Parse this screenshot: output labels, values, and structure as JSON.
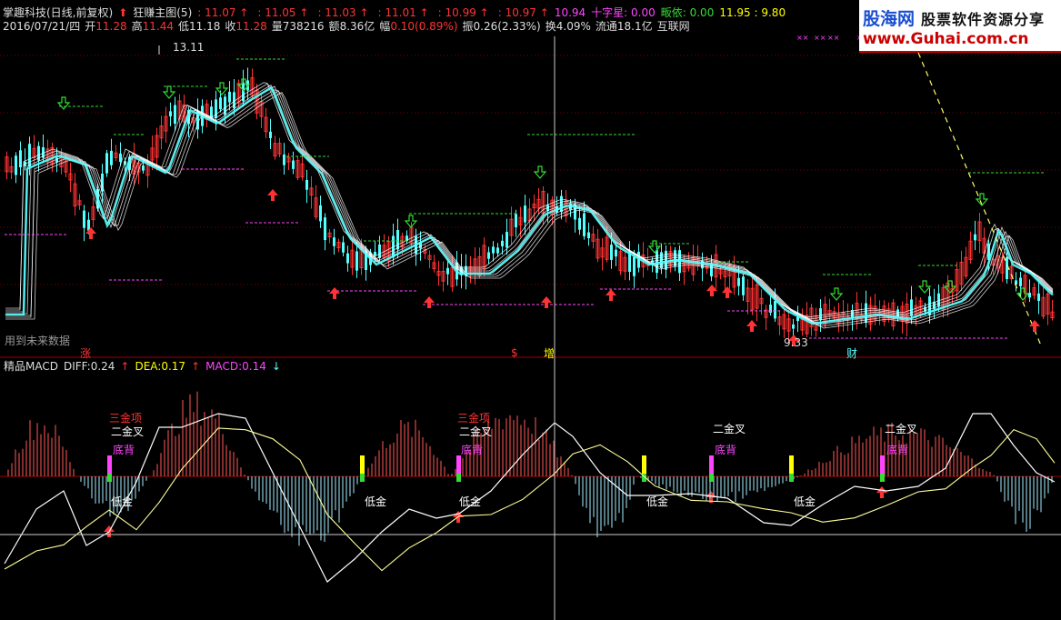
{
  "header": {
    "title": "掌趣科技(日线,前复权)",
    "indicator": "狂赚主图(5)",
    "ma_values": [
      "11.07",
      "11.05",
      "11.03",
      "11.01",
      "10.99",
      "10.97"
    ],
    "highlight_value": "10.94",
    "cross_star_label": "十字星: 0.00",
    "plate_label": "畈依: 0.00",
    "range_label": "11.95 : 9.80",
    "date": "2016/07/21/四",
    "open_label": "开",
    "open": "11.28",
    "high_label": "高",
    "high": "11.44",
    "low_label": "低",
    "low": "11.18",
    "close_label": "收",
    "close": "11.28",
    "volume_label": "量",
    "volume": "738216",
    "amount_label": "额",
    "amount": "8.36亿",
    "change_label": "幅",
    "change": "0.10(0.89%)",
    "amplitude_label": "振",
    "amplitude": "0.26(2.33%)",
    "turnover_label": "换",
    "turnover": "4.09%",
    "float_label": "流通",
    "float": "18.1亿",
    "source": "互联网"
  },
  "watermark": {
    "site": "股海网",
    "tagline": "股票软件资源分享",
    "url": "www.Guhai.com.cn"
  },
  "main_panel": {
    "price_high_label": "13.11",
    "price_low_label": "9.33",
    "future_data_label": "用到未来数据",
    "markers": [
      "涨",
      "$",
      "增",
      "财"
    ]
  },
  "macd_panel": {
    "title": "精品MACD",
    "diff_label": "DIFF:",
    "diff": "0.24",
    "dea_label": "DEA:",
    "dea": "0.17",
    "macd_label": "MACD:",
    "macd": "0.14",
    "signals": {
      "triple_gold": "三金项",
      "double_gold": "二金叉",
      "bottom_div": "底背",
      "low_gold": "低金"
    }
  },
  "colors": {
    "up": "#ff3333",
    "down": "#54ffff",
    "white": "#ffffff",
    "yellow": "#ffff00",
    "magenta": "#ff44ff",
    "green": "#33dd33",
    "grid": "#7a0000",
    "panel_line": "#a00000"
  }
}
